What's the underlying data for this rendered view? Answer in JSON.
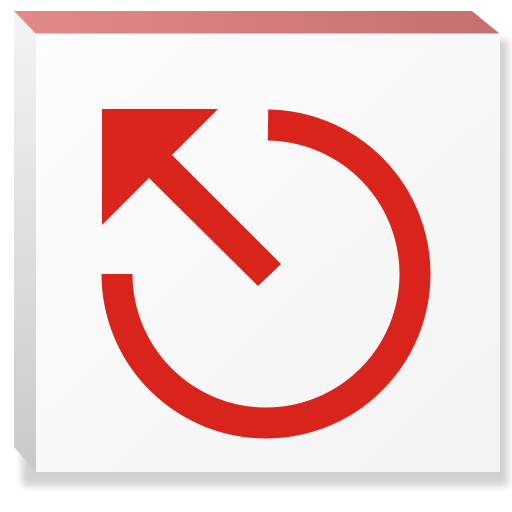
{
  "app_icon": {
    "icon": "restore-arrow-icon",
    "colors": {
      "accent": "#d9241c",
      "tile_face": "#fbfbfb",
      "top_edge_light": "#e28a89",
      "top_edge_dark": "#c3706e",
      "side_edge_dark": "#c9c9c9",
      "side_edge_light": "#f4f4f4"
    }
  }
}
